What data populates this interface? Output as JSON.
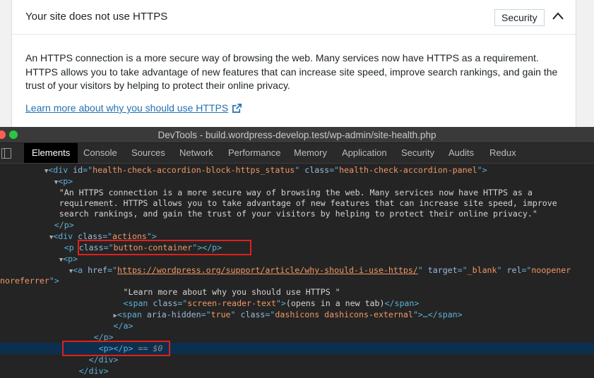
{
  "wp_panel": {
    "title": "Your site does not use HTTPS",
    "badge": "Security",
    "description": "An HTTPS connection is a more secure way of browsing the web. Many services now have HTTPS as a requirement. HTTPS allows you to take advantage of new features that can increase site speed, improve search rankings, and gain the trust of your visitors by helping to protect their online privacy.",
    "learn_more": "Learn more about why you should use HTTPS"
  },
  "devtools": {
    "window_title": "DevTools - build.wordpress-develop.test/wp-admin/site-health.php",
    "tabs": [
      "Elements",
      "Console",
      "Sources",
      "Network",
      "Performance",
      "Memory",
      "Application",
      "Security",
      "Audits",
      "Redux"
    ],
    "active_tab": "Elements",
    "code": {
      "div_open_tag": "div",
      "div_attr1_name": "id",
      "div_attr1_value": "health-check-accordion-block-https_status",
      "div_attr2_name": "class",
      "div_attr2_value": "health-check-accordion-panel",
      "p_tag": "p",
      "p_text1": "\"An HTTPS connection is a more secure way of browsing the web. Many services now have HTTPS as a",
      "p_text2": "requirement. HTTPS allows you to take advantage of new features that can increase site speed, improve",
      "p_text3": "search rankings, and gain the trust of your visitors by helping to protect their online privacy.\"",
      "p_close": "</p>",
      "actions_tag": "div",
      "actions_attr_name": "class",
      "actions_attr_value": "actions",
      "button_p_attr_name": "class",
      "button_p_attr_value": "button-container",
      "p2_open": "<p>",
      "a_attr1_name": "href",
      "a_attr1_value": "https://wordpress.org/support/article/why-should-i-use-https/",
      "a_attr2_name": "target",
      "a_attr2_value": "_blank",
      "a_attr3_name": "rel",
      "a_attr3_value": "noopener",
      "a_rel_cont": "noreferrer\">",
      "a_text": "\"Learn more about why you should use HTTPS \"",
      "span1_attr_name": "class",
      "span1_attr_value": "screen-reader-text",
      "span1_text": "(opens in a new tab)",
      "span2_attr1_name": "aria-hidden",
      "span2_attr1_value": "true",
      "span2_attr2_name": "class",
      "span2_attr2_value": "dashicons dashicons-external",
      "a_close": "</a>",
      "p2_close": "</p>",
      "empty_p": "<p></p>",
      "selected_eq": "== $0",
      "div_close1": "</div>",
      "div_close2": "</div>"
    }
  }
}
